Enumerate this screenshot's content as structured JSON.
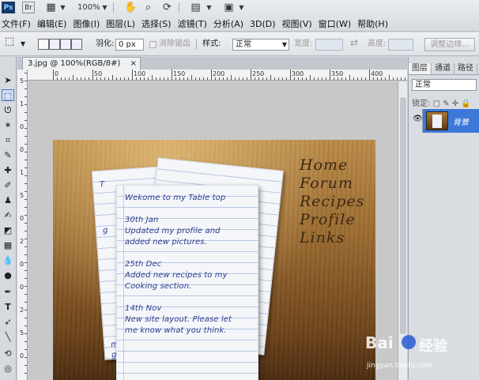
{
  "app": {
    "logo_text": "Ps",
    "quick_labels": [
      "Br",
      "100%"
    ]
  },
  "menus": [
    "文件(F)",
    "编辑(E)",
    "图像(I)",
    "图层(L)",
    "选择(S)",
    "滤镜(T)",
    "分析(A)",
    "3D(D)",
    "视图(V)",
    "窗口(W)",
    "帮助(H)"
  ],
  "options": {
    "feather_label": "羽化:",
    "feather_value": "0 px",
    "antialias_label": "消除锯齿",
    "style_label": "样式:",
    "style_value": "正常",
    "width_label": "宽度:",
    "height_label": "高度:",
    "refine_button": "调整边缘..."
  },
  "document": {
    "tab_title": "3.jpg @ 100%(RGB/8#)",
    "close_glyph": "×",
    "ruler_labels": [
      "0",
      "50",
      "100",
      "150",
      "200",
      "250",
      "300",
      "350",
      "400",
      "450"
    ],
    "ruler_v_labels": [
      "5",
      "1",
      "0",
      "0",
      "1",
      "5",
      "0",
      "2",
      "0",
      "0",
      "2",
      "5",
      "0"
    ]
  },
  "image_content": {
    "nav_links": [
      "Home",
      "Forum",
      "Recipes",
      "Profile",
      "Links"
    ],
    "note_lines": [
      "Wekome to my Table top",
      "30th Jan",
      "Updated my profile and",
      "added new pictures.",
      "25th Dec",
      "Added new recipes to my",
      "Cooking section.",
      "14th Nov",
      "New site layout. Please let",
      "me know what you think."
    ],
    "back_left_letters": [
      "T",
      "g",
      "my",
      "go"
    ]
  },
  "panel": {
    "tabs": [
      "图层",
      "通道",
      "路径"
    ],
    "blend_mode": "正常",
    "lock_label": "锁定:",
    "layer_name": "背景"
  },
  "watermark": {
    "brand": "Bai",
    "brand2": "经验",
    "url": "jingyan.baidu.com"
  },
  "colors": {
    "accent": "#3c78d8",
    "handwriting": "#2d3a8c",
    "menu_bg": "#e2e5e9"
  }
}
